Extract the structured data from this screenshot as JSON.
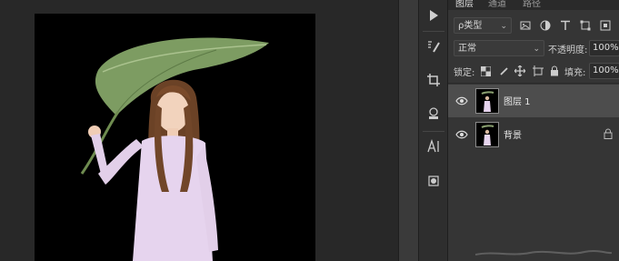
{
  "panel": {
    "tabs": [
      {
        "label": "图层",
        "active": true
      },
      {
        "label": "通道",
        "active": false
      },
      {
        "label": "路径",
        "active": false
      }
    ],
    "filter": {
      "label": "ρ类型"
    },
    "blend_mode": "正常",
    "opacity": {
      "label": "不透明度:",
      "value": "100%"
    },
    "lock": {
      "label": "锁定:"
    },
    "fill": {
      "label": "填充:",
      "value": "100%"
    },
    "layers": [
      {
        "name": "图层 1",
        "selected": true,
        "visible": true,
        "locked": false
      },
      {
        "name": "背景",
        "selected": false,
        "visible": true,
        "locked": true
      }
    ]
  },
  "toolstrip": {
    "tools": [
      {
        "icon": "play-icon"
      },
      {
        "icon": "brush-settings-icon"
      },
      {
        "icon": "crop-icon"
      },
      {
        "icon": "stamp-icon"
      },
      {
        "icon": "character-text-icon"
      },
      {
        "icon": "3d-material-icon"
      }
    ]
  },
  "colors": {
    "canvas_bg": "#282828",
    "document_bg": "#000000",
    "panel_bg": "#353535",
    "selected_layer": "#4d4d4d"
  }
}
